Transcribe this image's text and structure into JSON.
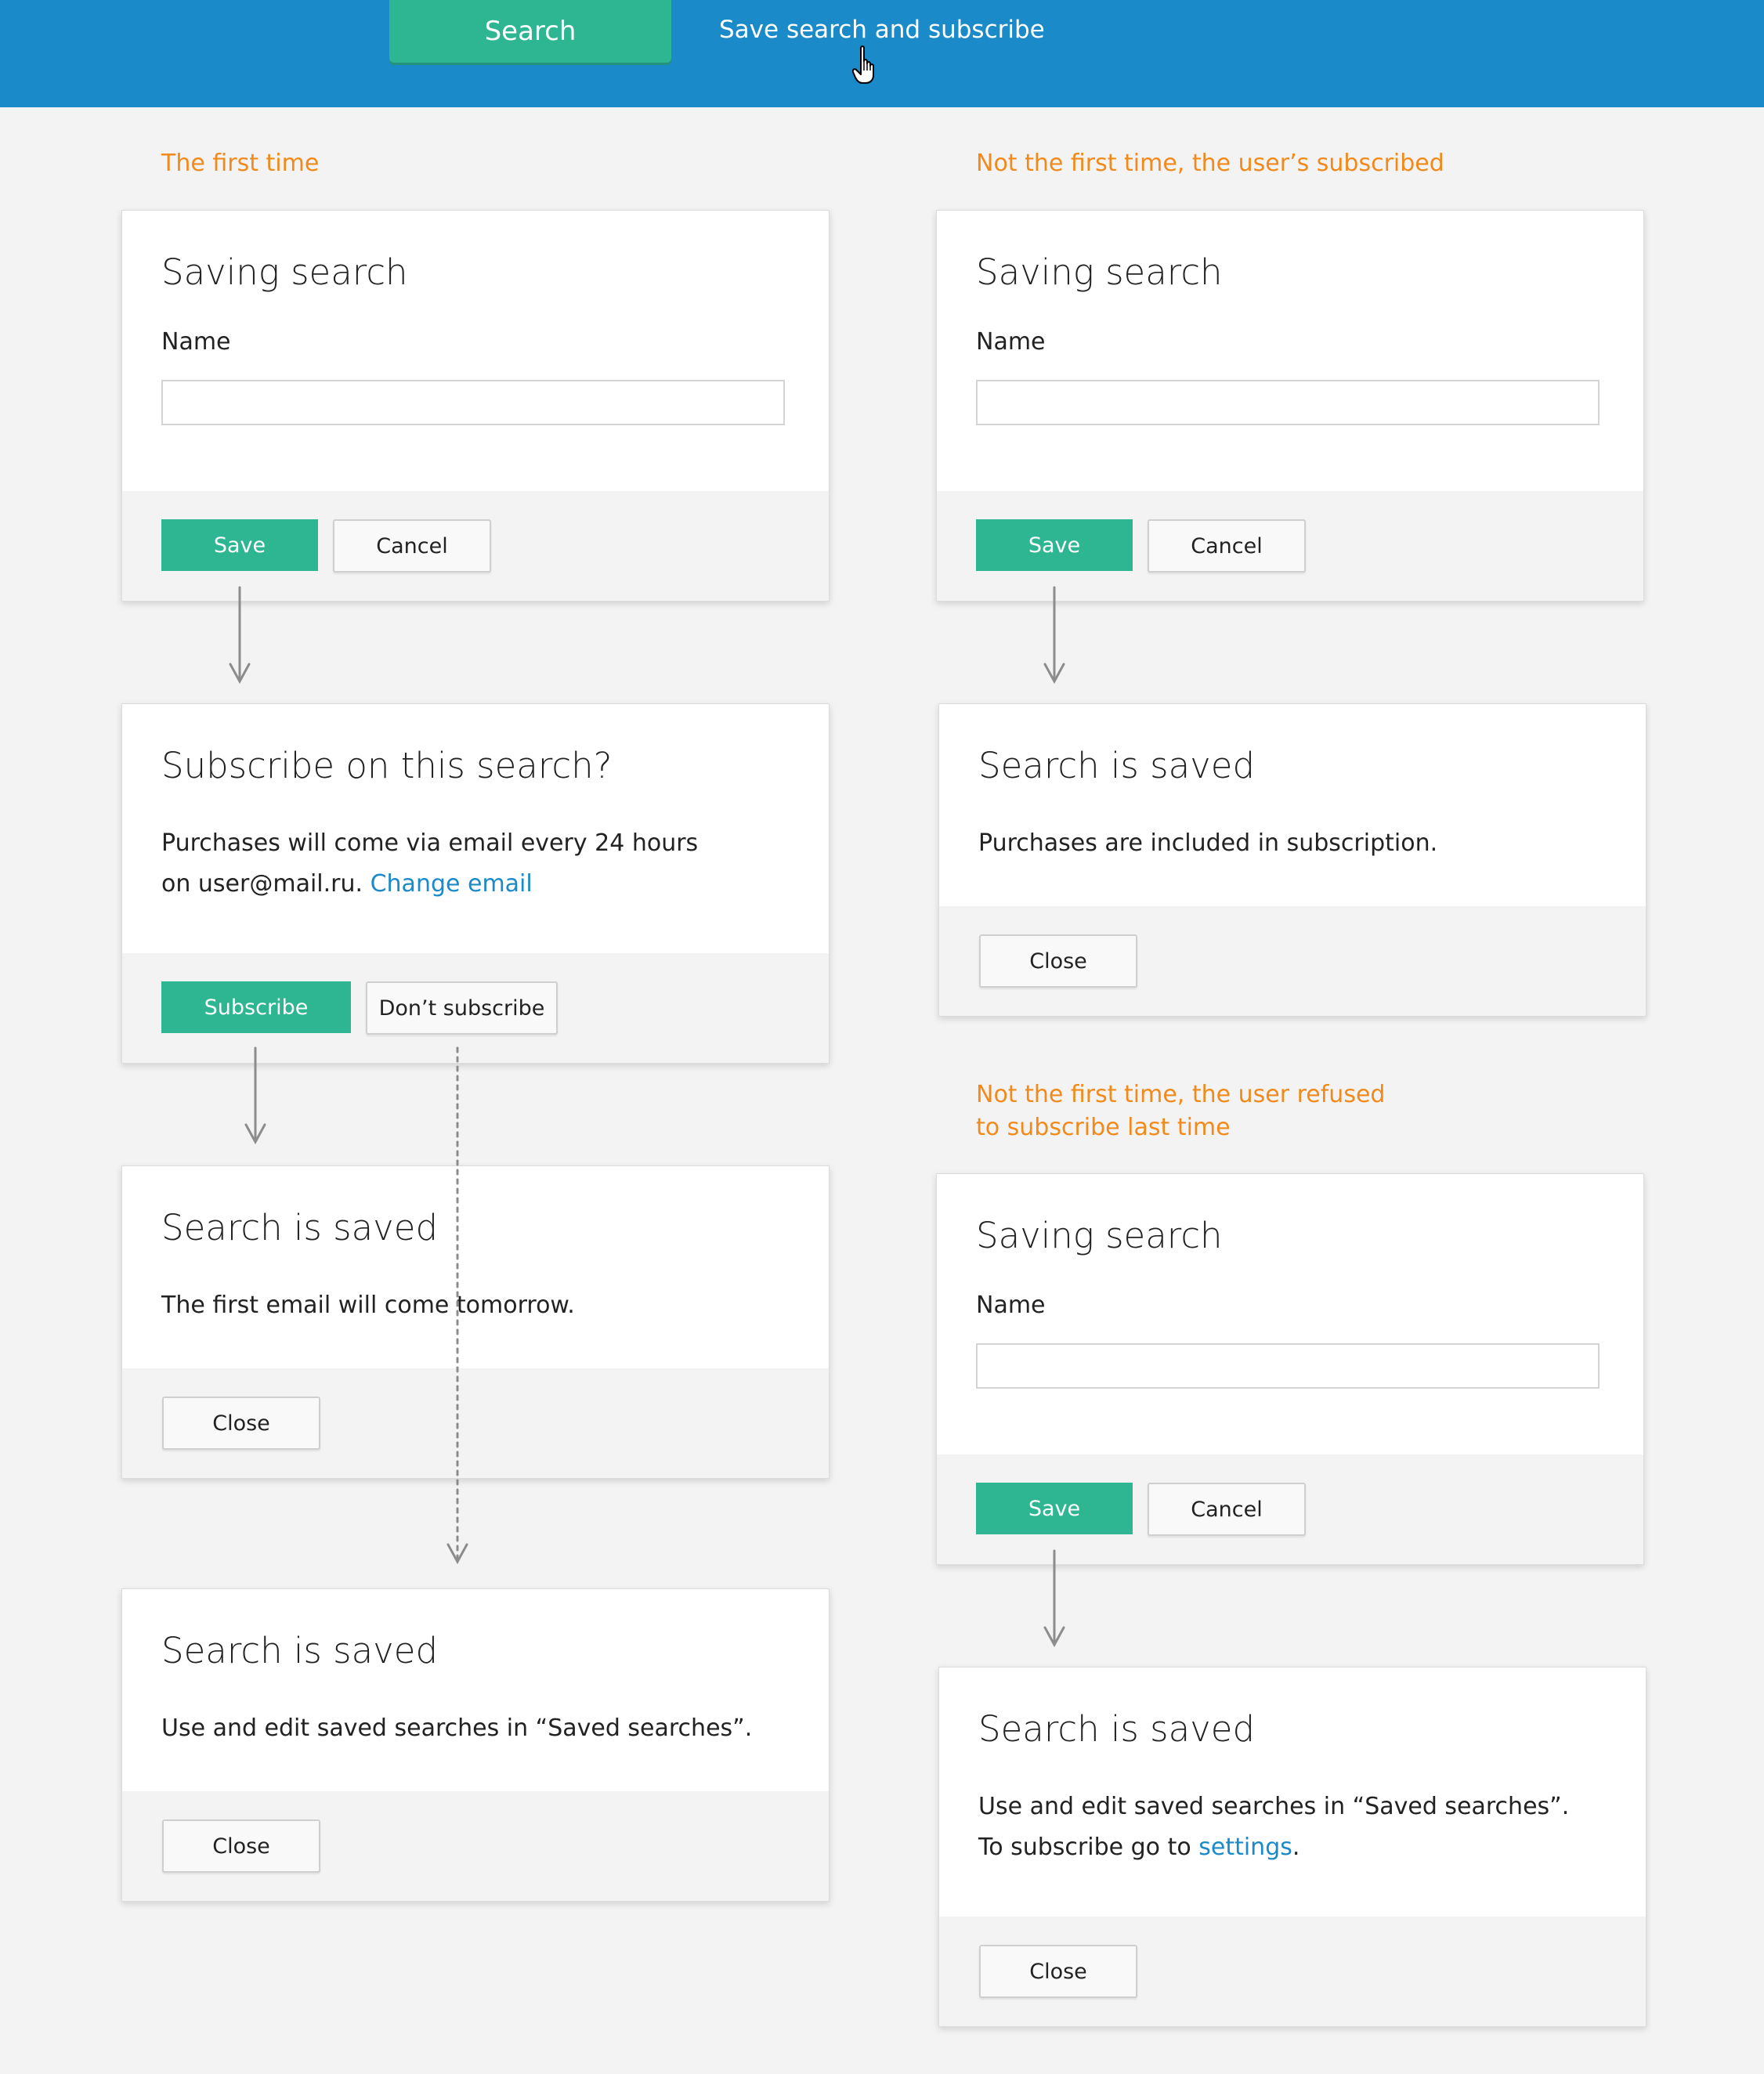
{
  "topbar": {
    "search_button": "Search",
    "save_subscribe_link": "Save search and subscribe"
  },
  "captions": {
    "first_time": "The first time",
    "subscribed": "Not the first time, the user’s subscribed",
    "refused_line1": "Not the first time, the user refused",
    "refused_line2": "to subscribe last time"
  },
  "dialogs": {
    "saving_first": {
      "title": "Saving search",
      "label": "Name",
      "input_value": "",
      "save": "Save",
      "cancel": "Cancel"
    },
    "subscribe": {
      "title": "Subscribe on this search?",
      "line1": "Purchases will come via email every 24 hours",
      "line2_prefix": "on user@mail.ru.",
      "change_email": "Change email",
      "subscribe": "Subscribe",
      "dont_subscribe": "Don’t subscribe"
    },
    "saved_first_email": {
      "title": "Search is saved",
      "text": "The first email will come tomorrow.",
      "close": "Close"
    },
    "saved_use_edit": {
      "title": "Search is saved",
      "text": "Use and edit saved searches in “Saved searches”.",
      "close": "Close"
    },
    "saving_subscribed": {
      "title": "Saving search",
      "label": "Name",
      "input_value": "",
      "save": "Save",
      "cancel": "Cancel"
    },
    "saved_included": {
      "title": "Search is saved",
      "text": "Purchases are included in subscription.",
      "close": "Close"
    },
    "saving_refused": {
      "title": "Saving search",
      "label": "Name",
      "input_value": "",
      "save": "Save",
      "cancel": "Cancel"
    },
    "saved_settings": {
      "title": "Search is saved",
      "line1": "Use and edit saved searches in “Saved searches”.",
      "line2_prefix": "To subscribe go to",
      "settings_link": "settings",
      "line2_suffix": ".",
      "close": "Close"
    }
  },
  "colors": {
    "topbar": "#1a8ac9",
    "accent_green": "#2eb592",
    "caption_orange": "#f28a1b",
    "link_blue": "#1a8ac9"
  },
  "icons": {
    "cursor": "hand-pointer-icon"
  }
}
